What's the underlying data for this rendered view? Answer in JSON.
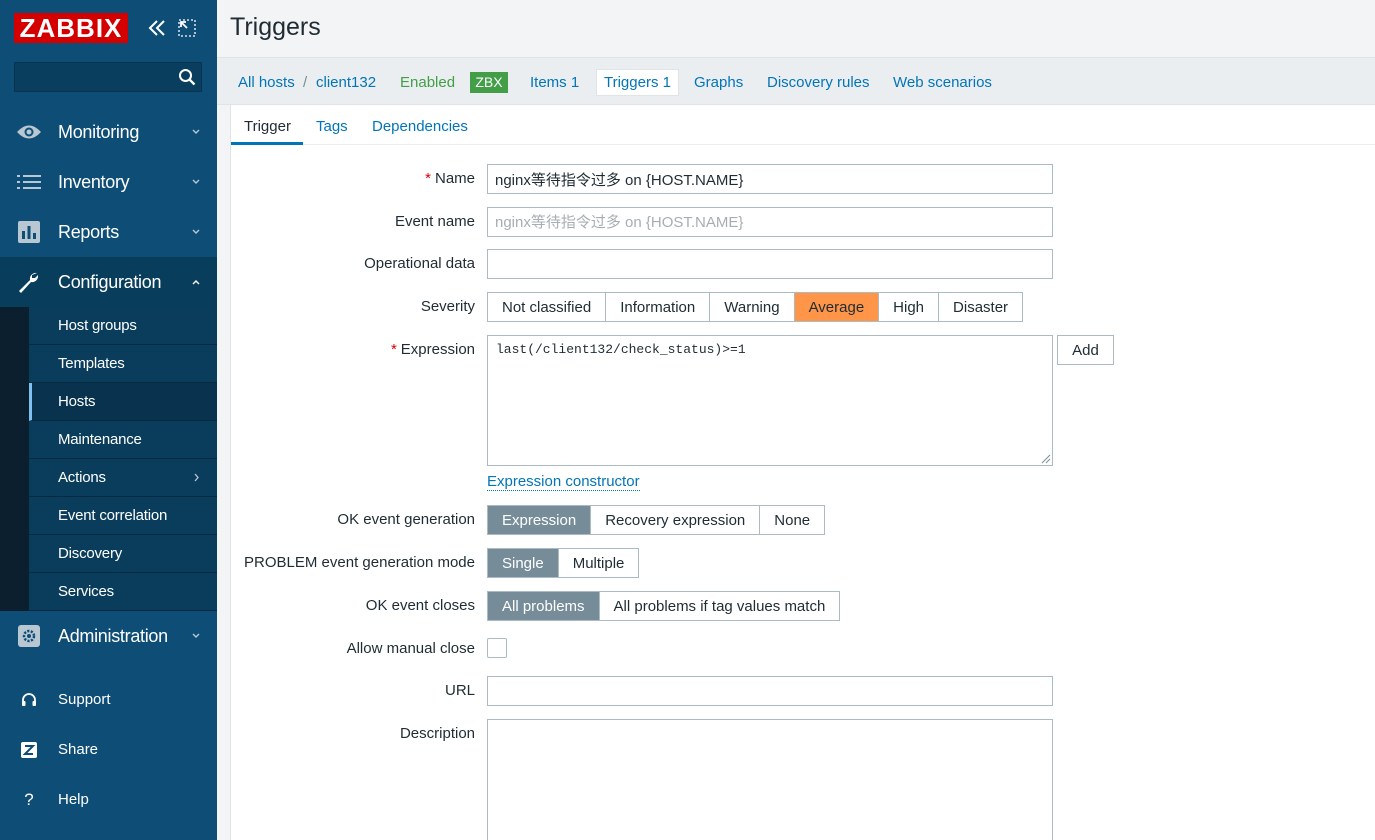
{
  "sidebar": {
    "logo": "ZABBIX",
    "search_value": "",
    "menu": [
      {
        "label": "Monitoring",
        "icon": "eye-icon"
      },
      {
        "label": "Inventory",
        "icon": "list-icon"
      },
      {
        "label": "Reports",
        "icon": "bar-chart-icon"
      },
      {
        "label": "Configuration",
        "icon": "wrench-icon"
      }
    ],
    "config_submenu": [
      {
        "label": "Host groups"
      },
      {
        "label": "Templates"
      },
      {
        "label": "Hosts"
      },
      {
        "label": "Maintenance"
      },
      {
        "label": "Actions"
      },
      {
        "label": "Event correlation"
      },
      {
        "label": "Discovery"
      },
      {
        "label": "Services"
      }
    ],
    "administration": {
      "label": "Administration",
      "icon": "gear-icon"
    },
    "bottom": [
      {
        "label": "Support",
        "icon": "headset-icon"
      },
      {
        "label": "Share",
        "icon": "share-z-icon"
      },
      {
        "label": "Help",
        "icon": "question-icon"
      }
    ]
  },
  "header": {
    "title": "Triggers"
  },
  "host_nav": {
    "all_hosts": "All hosts",
    "separator": "/",
    "host": "client132",
    "status": "Enabled",
    "zbx_badge": "ZBX",
    "items": "Items 1",
    "triggers": "Triggers 1",
    "graphs": "Graphs",
    "discovery": "Discovery rules",
    "web": "Web scenarios"
  },
  "tabs": {
    "trigger": "Trigger",
    "tags": "Tags",
    "dependencies": "Dependencies"
  },
  "form": {
    "name_label": "Name",
    "name_value": "nginx等待指令过多 on {HOST.NAME}",
    "event_name_label": "Event name",
    "event_name_placeholder": "nginx等待指令过多 on {HOST.NAME}",
    "opdata_label": "Operational data",
    "opdata_value": "",
    "severity_label": "Severity",
    "severity_options": [
      "Not classified",
      "Information",
      "Warning",
      "Average",
      "High",
      "Disaster"
    ],
    "severity_selected": "Average",
    "expression_label": "Expression",
    "expression_value": "last(/client132/check_status)>=1",
    "add_button": "Add",
    "expression_constructor": "Expression constructor",
    "ok_event_gen_label": "OK event generation",
    "ok_event_gen_options": [
      "Expression",
      "Recovery expression",
      "None"
    ],
    "problem_mode_label": "PROBLEM event generation mode",
    "problem_mode_options": [
      "Single",
      "Multiple"
    ],
    "ok_closes_label": "OK event closes",
    "ok_closes_options": [
      "All problems",
      "All problems if tag values match"
    ],
    "manual_close_label": "Allow manual close",
    "manual_close_checked": false,
    "url_label": "URL",
    "url_value": "",
    "description_label": "Description",
    "description_value": ""
  },
  "colors": {
    "sidebar": "#0e4e76",
    "brand_red": "#d40000",
    "link": "#0275b8",
    "enabled_green": "#429e47",
    "severity_average": "#ff9548",
    "selected_gray": "#768d99"
  }
}
